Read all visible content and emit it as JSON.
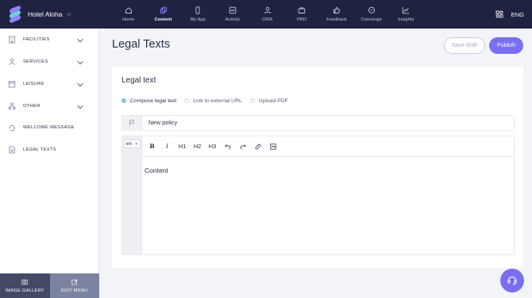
{
  "brand": {
    "name": "Hotel Aloha"
  },
  "nav": [
    {
      "label": "Home",
      "icon": "home-icon"
    },
    {
      "label": "Content",
      "icon": "content-icon"
    },
    {
      "label": "My App",
      "icon": "phone-icon"
    },
    {
      "label": "Activity",
      "icon": "activity-icon"
    },
    {
      "label": "CRM",
      "icon": "users-icon"
    },
    {
      "label": "PRO",
      "icon": "pro-icon"
    },
    {
      "label": "Feedback",
      "icon": "thumbs-up-icon"
    },
    {
      "label": "Concierge",
      "icon": "chat-icon"
    },
    {
      "label": "Insights",
      "icon": "chart-icon"
    }
  ],
  "language": "ENG",
  "sidebar": {
    "items": [
      {
        "label": "FACILITIES",
        "icon": "building-icon",
        "expandable": true
      },
      {
        "label": "SERVICES",
        "icon": "person-icon",
        "expandable": true
      },
      {
        "label": "LEISURE",
        "icon": "calendar-icon",
        "expandable": true
      },
      {
        "label": "OTHER",
        "icon": "nodes-icon",
        "expandable": true
      },
      {
        "label": "WELCOME MESSAGE",
        "icon": "wave-icon",
        "expandable": false
      },
      {
        "label": "LEGAL TEXTS",
        "icon": "document-icon",
        "expandable": false
      }
    ],
    "bottom": {
      "gallery_label": "IMAGE GALLERY",
      "edit_label": "EDIT MENU"
    }
  },
  "page": {
    "title": "Legal Texts",
    "save_draft_label": "Save draft",
    "publish_label": "Publish"
  },
  "card": {
    "title": "Legal text",
    "options": [
      {
        "label": "Compose legal text",
        "selected": true
      },
      {
        "label": "Link to external URL",
        "selected": false
      },
      {
        "label": "Upload PDF",
        "selected": false
      }
    ],
    "policy_title_value": "New policy",
    "editor": {
      "language": "en",
      "toolbar": [
        "B",
        "I",
        "H1",
        "H2",
        "H3"
      ],
      "content_placeholder": "Content"
    }
  },
  "colors": {
    "topbar": "#1f2340",
    "accent": "#7a6ff2",
    "radio": "#7fc9cc"
  }
}
